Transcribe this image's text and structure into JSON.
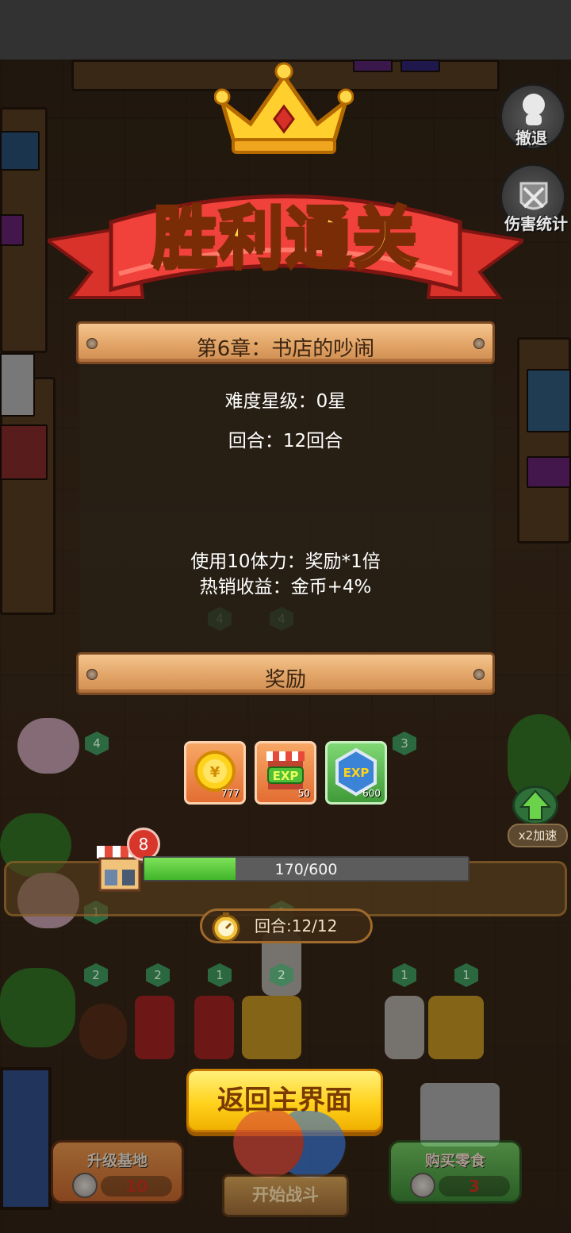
{
  "header": {
    "retreat_label": "撤退",
    "damage_stats_label": "伤害统计"
  },
  "banner": {
    "title": "胜利通关"
  },
  "chapter": {
    "title": "第6章：书店的吵闹",
    "difficulty": "难度星级：0星",
    "rounds": "回合：12回合",
    "energy_reward": "使用10体力：奖励*1倍",
    "hot_sale": "热销收益：金币+4%"
  },
  "rewards": {
    "title": "奖励",
    "items": [
      {
        "icon": "gold-coin-icon",
        "count": "777",
        "color": "#f08a3c"
      },
      {
        "icon": "shop-exp-icon",
        "count": "50",
        "color": "#e8613f"
      },
      {
        "icon": "exp-icon",
        "count": "600",
        "color": "#55b84a"
      }
    ]
  },
  "progress": {
    "level": "8",
    "text": "170/600",
    "fraction": 0.283
  },
  "round_display": "回合:12/12",
  "return_button": "返回主界面",
  "bottom": {
    "upgrade_label": "升级基地",
    "upgrade_count": "10",
    "buy_label": "购买零食",
    "buy_count": "3",
    "start_label": "开始战斗",
    "speed_label": "x2加速"
  },
  "tile_levels": [
    "4",
    "4",
    "4",
    "3",
    "1",
    "2",
    "2",
    "2",
    "1",
    "2",
    "1",
    "1"
  ]
}
